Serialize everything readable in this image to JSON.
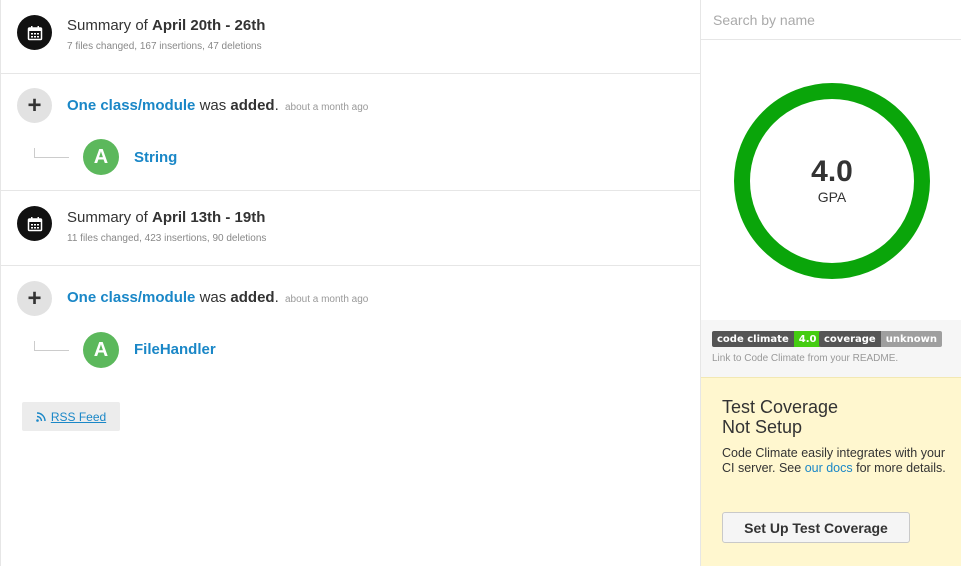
{
  "feed": {
    "summaries": [
      {
        "prefix": "Summary of",
        "range": "April 20th - 26th",
        "stats": "7 files changed, 167 insertions, 47 deletions"
      },
      {
        "prefix": "Summary of",
        "range": "April 13th - 19th",
        "stats": "11 files changed, 423 insertions, 90 deletions"
      }
    ],
    "events": [
      {
        "subject": "One class/module",
        "verb": "was",
        "action": "added",
        "punct": ".",
        "ago": "about a month ago",
        "grade": "A",
        "entity": "String"
      },
      {
        "subject": "One class/module",
        "verb": "was",
        "action": "added",
        "punct": ".",
        "ago": "about a month ago",
        "grade": "A",
        "entity": "FileHandler"
      }
    ],
    "rss_label": "RSS Feed"
  },
  "sidebar": {
    "search_placeholder": "Search by name",
    "gpa": {
      "value": "4.0",
      "label": "GPA",
      "ring_color": "#0aa50a"
    },
    "badges": {
      "cc_left": "code climate",
      "cc_right": "4.0",
      "cov_left": "coverage",
      "cov_right": "unknown",
      "note": "Link to Code Climate from your README."
    },
    "coverage": {
      "title_line1": "Test Coverage",
      "title_line2": "Not Setup",
      "desc_before": "Code Climate easily integrates with your CI server. See",
      "link": "our docs",
      "desc_after": "for more details.",
      "button": "Set Up Test Coverage"
    }
  },
  "colors": {
    "link": "#1a87c7",
    "grade_a": "#5cb85c",
    "coverage_bg": "#fff7cf"
  }
}
